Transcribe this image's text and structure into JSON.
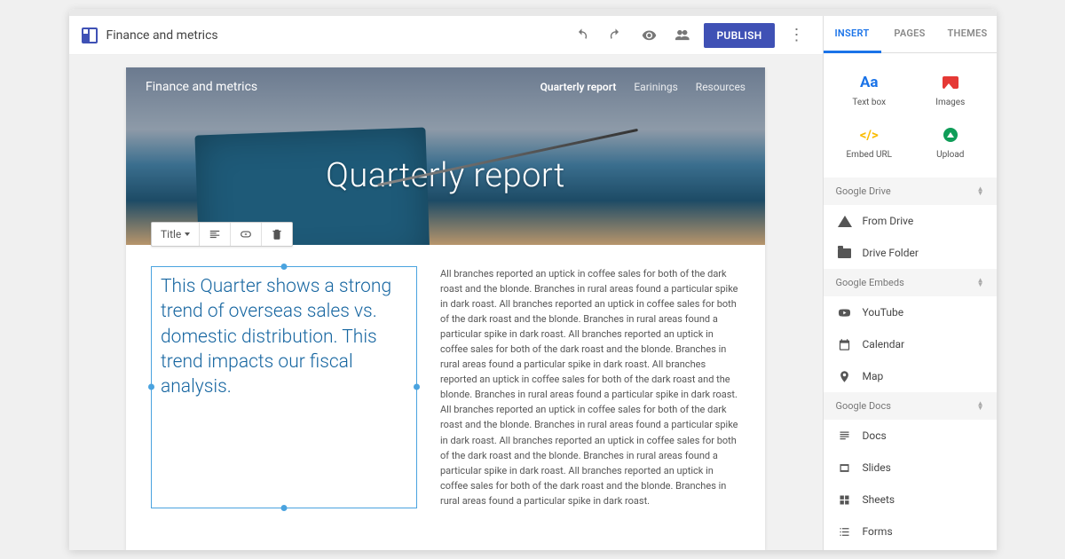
{
  "toolbar": {
    "doc_title": "Finance and metrics",
    "publish_label": "PUBLISH"
  },
  "hero": {
    "site_title": "Finance and metrics",
    "nav": [
      {
        "label": "Quarterly report",
        "active": true
      },
      {
        "label": "Earinings",
        "active": false
      },
      {
        "label": "Resources",
        "active": false
      }
    ],
    "page_title": "Quarterly report"
  },
  "editor_toolbar": {
    "style_label": "Title"
  },
  "content": {
    "headline": "This Quarter shows a strong trend of overseas sales vs. domestic distribution.  This trend impacts our fiscal analysis.",
    "body": "All branches reported an uptick in coffee sales for both of the dark roast and the blonde.  Branches in rural areas found a particular spike in dark roast.  All branches reported an uptick in coffee sales for both of the dark roast and the blonde.  Branches in rural areas found a particular spike in dark roast.  All branches reported an uptick in coffee sales for both of the dark roast and the blonde.  Branches in rural areas found a particular spike in dark roast.  All branches reported an uptick in coffee sales for both of the dark roast and the blonde.  Branches in rural areas found a particular spike in dark roast.  All branches reported an uptick in coffee sales for both of the dark roast and the blonde.  Branches in rural areas found a particular spike in dark roast.  All branches reported an uptick in coffee sales for both of the dark roast and the blonde.  Branches in rural areas found a particular spike in dark roast.  All branches reported an uptick in coffee sales for both of the dark roast and the blonde.  Branches in rural areas found a particular spike in dark roast."
  },
  "sidepanel": {
    "tabs": {
      "insert": "INSERT",
      "pages": "PAGES",
      "themes": "THEMES"
    },
    "tiles": {
      "textbox": "Text box",
      "images": "Images",
      "embed": "Embed URL",
      "upload": "Upload"
    },
    "sections": {
      "drive": "Google Drive",
      "embeds": "Google Embeds",
      "docs": "Google Docs"
    },
    "items": {
      "from_drive": "From Drive",
      "drive_folder": "Drive Folder",
      "youtube": "YouTube",
      "calendar": "Calendar",
      "map": "Map",
      "docs": "Docs",
      "slides": "Slides",
      "sheets": "Sheets",
      "forms": "Forms"
    }
  }
}
